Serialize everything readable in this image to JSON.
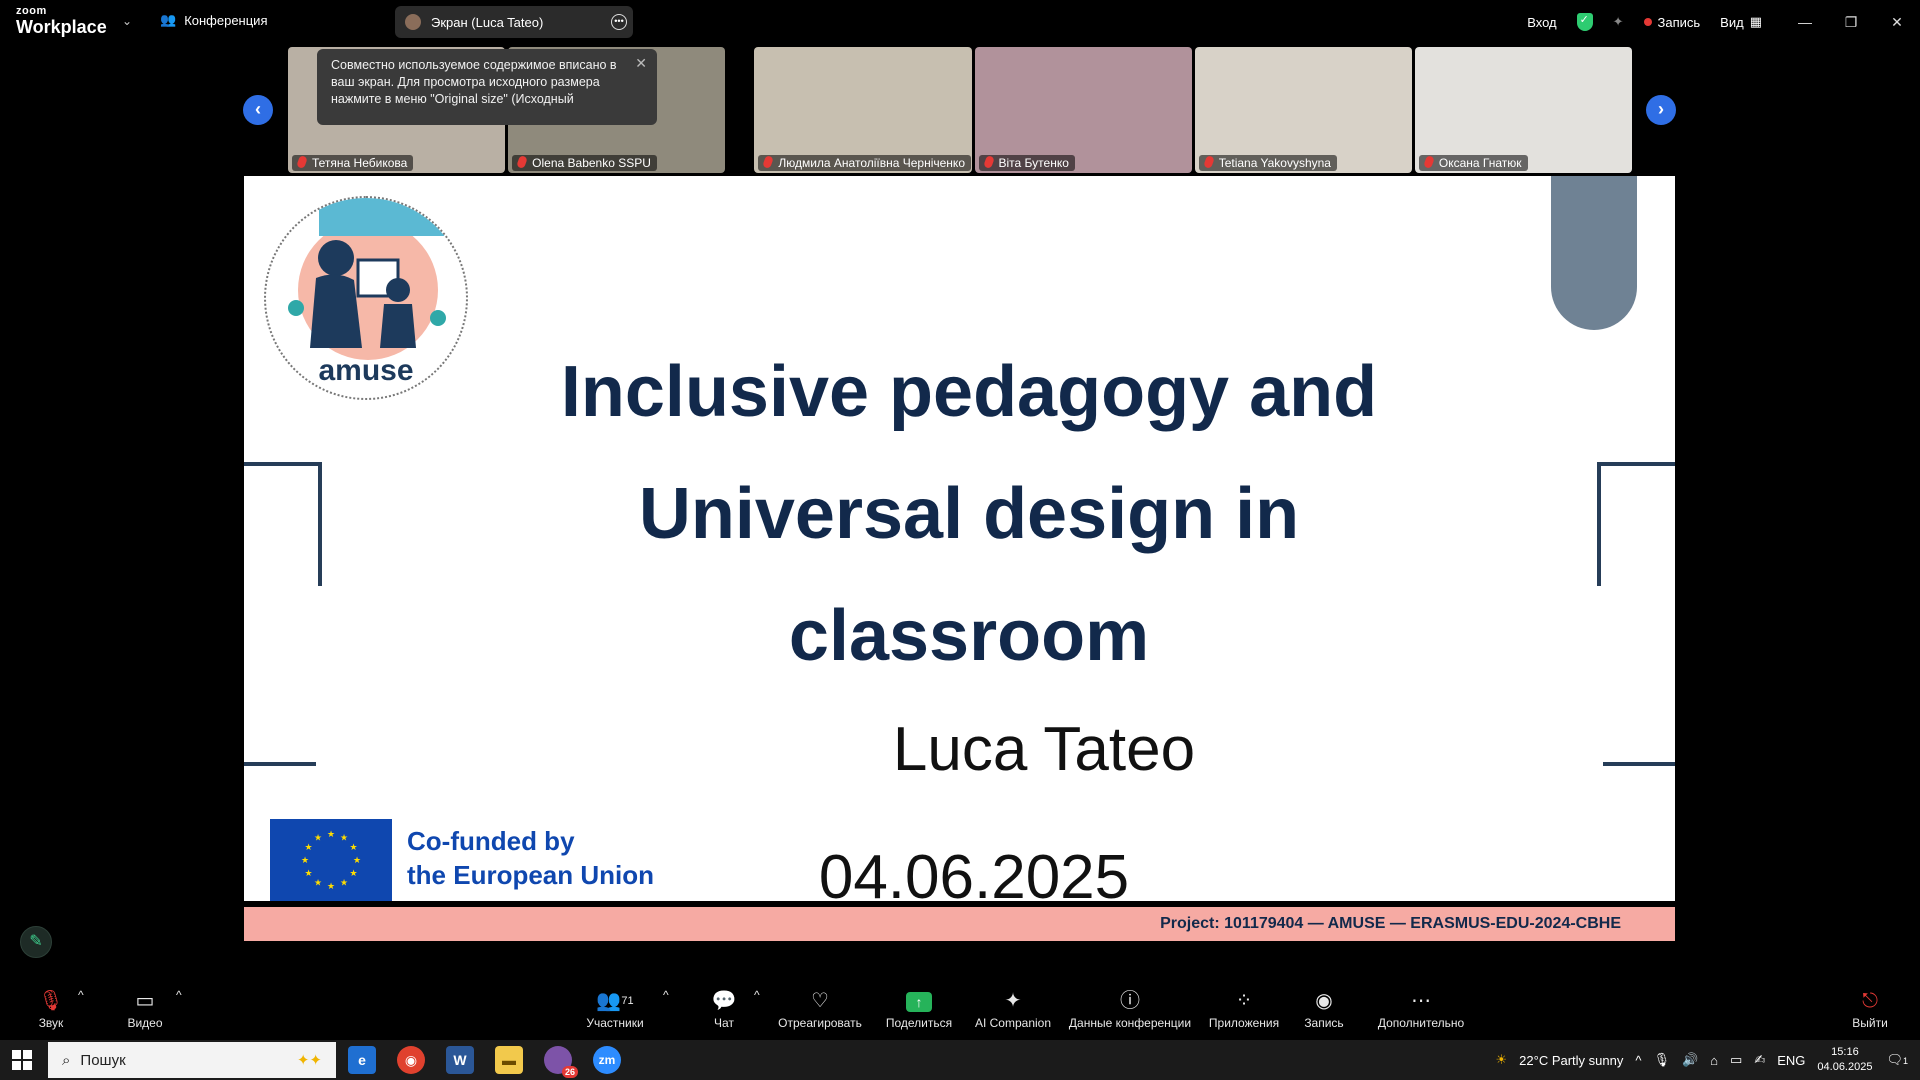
{
  "topbar": {
    "brand_top": "zoom",
    "brand_bottom": "Workplace",
    "meeting_label": "Конференция",
    "screen_share_label": "Экран (Luca Tateo)",
    "login_label": "Вход",
    "record_label": "Запись",
    "view_label": "Вид"
  },
  "tooltip": {
    "text": "Совместно используемое содержимое вписано в ваш экран. Для просмотра исходного размера нажмите в меню \"Original size\" (Исходный"
  },
  "participants": [
    {
      "name": "Тетяна Небикова",
      "color": "#b9b0a4"
    },
    {
      "name": "Olena Babenko SSPU",
      "color": "#8f8a7c"
    },
    {
      "name": "Людмила Анатоліївна Черніченко",
      "color": "#c7bfb0"
    },
    {
      "name": "Віта Бутенко",
      "color": "#b1929b"
    },
    {
      "name": "Tetiana Yakovyshyna",
      "color": "#d8d2c8"
    },
    {
      "name": "Оксана Гнатюк",
      "color": "#e3e1dd"
    }
  ],
  "slide": {
    "title_line1": "Inclusive pedagogy and",
    "title_line2": "Universal design in",
    "title_line3": "classroom",
    "author": "Luca Tateo",
    "date": "04.06.2025",
    "eu_line1": "Co-funded by",
    "eu_line2": "the European Union",
    "logo_text": "amuse",
    "project": "Project: 101179404 — AMUSE — ERASMUS-EDU-2024-CBHE"
  },
  "toolbar": {
    "audio": "Звук",
    "video": "Видео",
    "participants": "Участники",
    "participants_count": "71",
    "chat": "Чат",
    "react": "Отреагировать",
    "share": "Поделиться",
    "ai": "AI Companion",
    "info": "Данные конференции",
    "apps": "Приложения",
    "record": "Запись",
    "more": "Дополнительно",
    "leave": "Выйти"
  },
  "taskbar": {
    "search_placeholder": "Пошук",
    "weather": "22°C  Partly sunny",
    "lang": "ENG",
    "time": "15:16",
    "date": "04.06.2025",
    "viber_badge": "26",
    "notif_count": "1"
  },
  "colors": {
    "slide_title": "#12294b",
    "eu_blue": "#0f47af",
    "project_bar": "#f6aaa3",
    "accent_blue": "#2f6ee5",
    "share_green": "#26b35a"
  }
}
